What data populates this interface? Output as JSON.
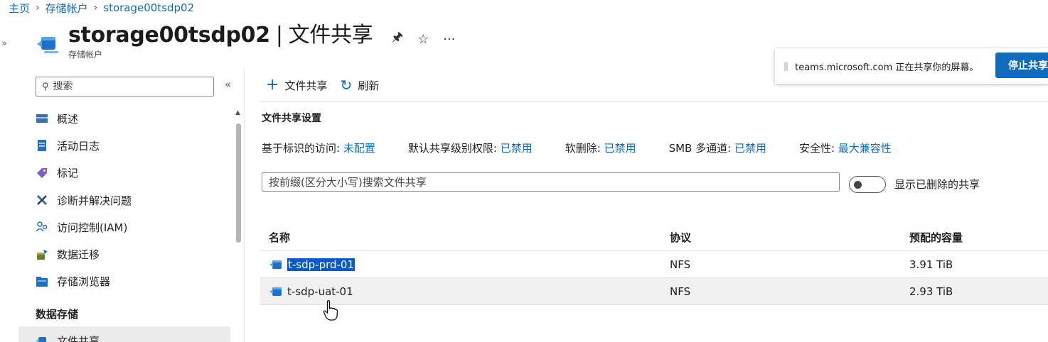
{
  "breadcrumb": {
    "home": "主页",
    "parent": "存储帐户",
    "current": "storage00tsdp02"
  },
  "header": {
    "resource_name": "storage00tsdp02",
    "separator": "|",
    "page_name": "文件共享",
    "resource_type": "存储帐户",
    "pin_icon": "pin-icon",
    "star_icon": "star-icon",
    "more": "···"
  },
  "sidebar": {
    "search_placeholder": "搜索",
    "collapse": "«",
    "items": [
      {
        "label": "概述",
        "icon": "overview-icon"
      },
      {
        "label": "活动日志",
        "icon": "activity-log-icon"
      },
      {
        "label": "标记",
        "icon": "tag-icon"
      },
      {
        "label": "诊断并解决问题",
        "icon": "wrench-icon"
      },
      {
        "label": "访问控制(IAM)",
        "icon": "people-icon"
      },
      {
        "label": "数据迁移",
        "icon": "migration-icon"
      },
      {
        "label": "存储浏览器",
        "icon": "storage-browser-icon"
      }
    ],
    "section_title": "数据存储",
    "selected_item": "文件共享"
  },
  "toolbar": {
    "add_label": "文件共享",
    "refresh_label": "刷新"
  },
  "settings": {
    "title": "文件共享设置",
    "items": [
      {
        "key": "基于标识的访问:",
        "value": "未配置"
      },
      {
        "key": "默认共享级别权限:",
        "value": "已禁用"
      },
      {
        "key": "软删除:",
        "value": "已禁用"
      },
      {
        "key": "SMB 多通道:",
        "value": "已禁用"
      },
      {
        "key": "安全性:",
        "value": "最大兼容性"
      }
    ]
  },
  "filter": {
    "placeholder": "按前缀(区分大小写)搜索文件共享"
  },
  "toggle": {
    "label": "显示已删除的共享",
    "on": false
  },
  "table": {
    "headers": [
      "名称",
      "协议",
      "预配的容量"
    ],
    "rows": [
      {
        "name": "t-sdp-prd-01",
        "protocol": "NFS",
        "capacity": "3.91 TiB"
      },
      {
        "name": "t-sdp-uat-01",
        "protocol": "NFS",
        "capacity": "2.93 TiB"
      }
    ]
  },
  "share_bar": {
    "message": "teams.microsoft.com 正在共享你的屏幕。",
    "stop_label": "停止共享"
  },
  "colors": {
    "accent": "#0f6cbd",
    "selection": "#0a59c9"
  }
}
